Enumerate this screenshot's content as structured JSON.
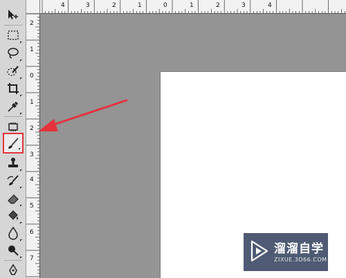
{
  "ruler": {
    "top_labels": [
      "4",
      "3",
      "2",
      "1",
      "0",
      "1",
      "2",
      "3",
      "4"
    ],
    "left_labels": [
      "2",
      "1",
      "0",
      "1",
      "2",
      "3",
      "4",
      "5",
      "6",
      "7"
    ]
  },
  "toolbar": {
    "tools": [
      {
        "name": "move-tool",
        "icon": "move-icon"
      },
      {
        "name": "marquee-tool",
        "icon": "marquee-icon"
      },
      {
        "name": "lasso-tool",
        "icon": "lasso-icon"
      },
      {
        "name": "quick-selection-tool",
        "icon": "quick-selection-icon"
      },
      {
        "name": "crop-tool",
        "icon": "crop-icon"
      },
      {
        "name": "eyedropper-tool",
        "icon": "eyedropper-icon"
      },
      {
        "name": "healing-brush-tool",
        "icon": "healing-brush-icon"
      },
      {
        "name": "brush-tool",
        "icon": "brush-icon",
        "active": true
      },
      {
        "name": "clone-stamp-tool",
        "icon": "clone-stamp-icon"
      },
      {
        "name": "history-brush-tool",
        "icon": "history-brush-icon"
      },
      {
        "name": "eraser-tool",
        "icon": "eraser-icon"
      },
      {
        "name": "paint-bucket-tool",
        "icon": "paint-bucket-icon"
      },
      {
        "name": "blur-tool",
        "icon": "blur-icon"
      },
      {
        "name": "dodge-tool",
        "icon": "dodge-icon"
      },
      {
        "name": "pen-tool",
        "icon": "pen-icon"
      }
    ],
    "highlight_color": "#e5333c"
  },
  "annotation": {
    "arrow_color": "#e5333c"
  },
  "watermark": {
    "title": "溜溜自学",
    "url": "ZIXUE.3D66.COM"
  }
}
